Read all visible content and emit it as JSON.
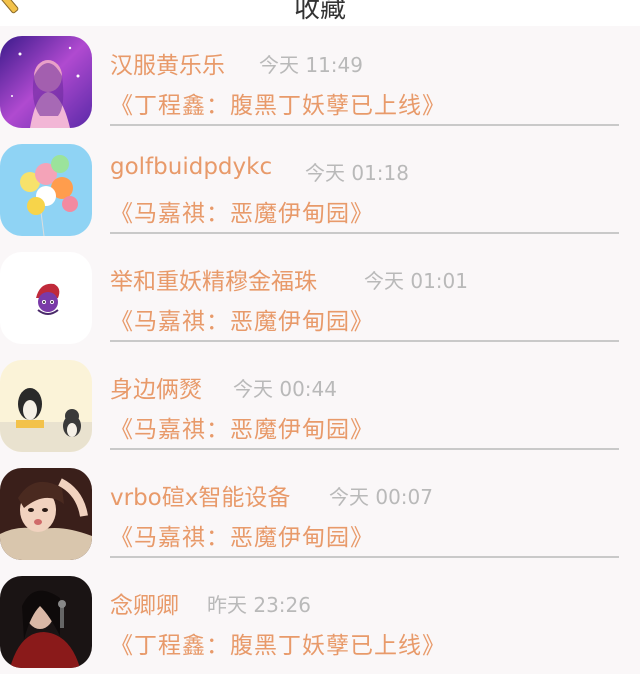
{
  "header": {
    "title": "收藏",
    "icon": "pencil-icon"
  },
  "items": [
    {
      "name": "汉服黄乐乐",
      "time": "今天 11:49",
      "subtitle": "《丁程鑫：腹黑丁妖孽已上线》",
      "avatar": "girl-starry-avatar-icon"
    },
    {
      "name": "golfbuidpdykc",
      "time": "今天 01:18",
      "subtitle": "《马嘉祺：恶魔伊甸园》",
      "avatar": "balloons-avatar-icon"
    },
    {
      "name": "举和重妖精穆金福珠",
      "time": "今天 01:01",
      "subtitle": "《马嘉祺：恶魔伊甸园》",
      "avatar": "cartoon-character-avatar-icon"
    },
    {
      "name": "身边俩燹",
      "time": "今天 00:44",
      "subtitle": "《马嘉祺：恶魔伊甸园》",
      "avatar": "penguins-avatar-icon"
    },
    {
      "name": "vrbo碹x智能设备",
      "time": "今天 00:07",
      "subtitle": "《马嘉祺：恶魔伊甸园》",
      "avatar": "girl-portrait-avatar-icon"
    },
    {
      "name": "念卿卿",
      "time": "昨天 23:26",
      "subtitle": "《丁程鑫：腹黑丁妖孽已上线》",
      "avatar": "singer-avatar-icon"
    }
  ],
  "colors": {
    "accent": "#e89a6a",
    "time": "#b9b9b9",
    "divider": "#c9c9c9"
  }
}
